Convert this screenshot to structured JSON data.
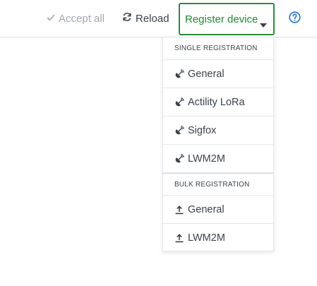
{
  "toolbar": {
    "accept_all_label": "Accept all",
    "reload_label": "Reload",
    "register_label": "Register device",
    "help_icon": "question-circle-icon"
  },
  "menu": {
    "single": {
      "header": "SINGLE REGISTRATION",
      "items": [
        {
          "label": "General",
          "icon": "satellite-icon"
        },
        {
          "label": "Actility LoRa",
          "icon": "satellite-icon"
        },
        {
          "label": "Sigfox",
          "icon": "satellite-icon"
        },
        {
          "label": "LWM2M",
          "icon": "satellite-icon"
        }
      ]
    },
    "bulk": {
      "header": "BULK REGISTRATION",
      "items": [
        {
          "label": "General",
          "icon": "upload-icon"
        },
        {
          "label": "LWM2M",
          "icon": "upload-icon"
        }
      ]
    }
  },
  "colors": {
    "accent_green": "#1f8a2f",
    "help_blue": "#1f6fd1",
    "text": "#3b4249",
    "disabled": "#a3a8ae"
  }
}
